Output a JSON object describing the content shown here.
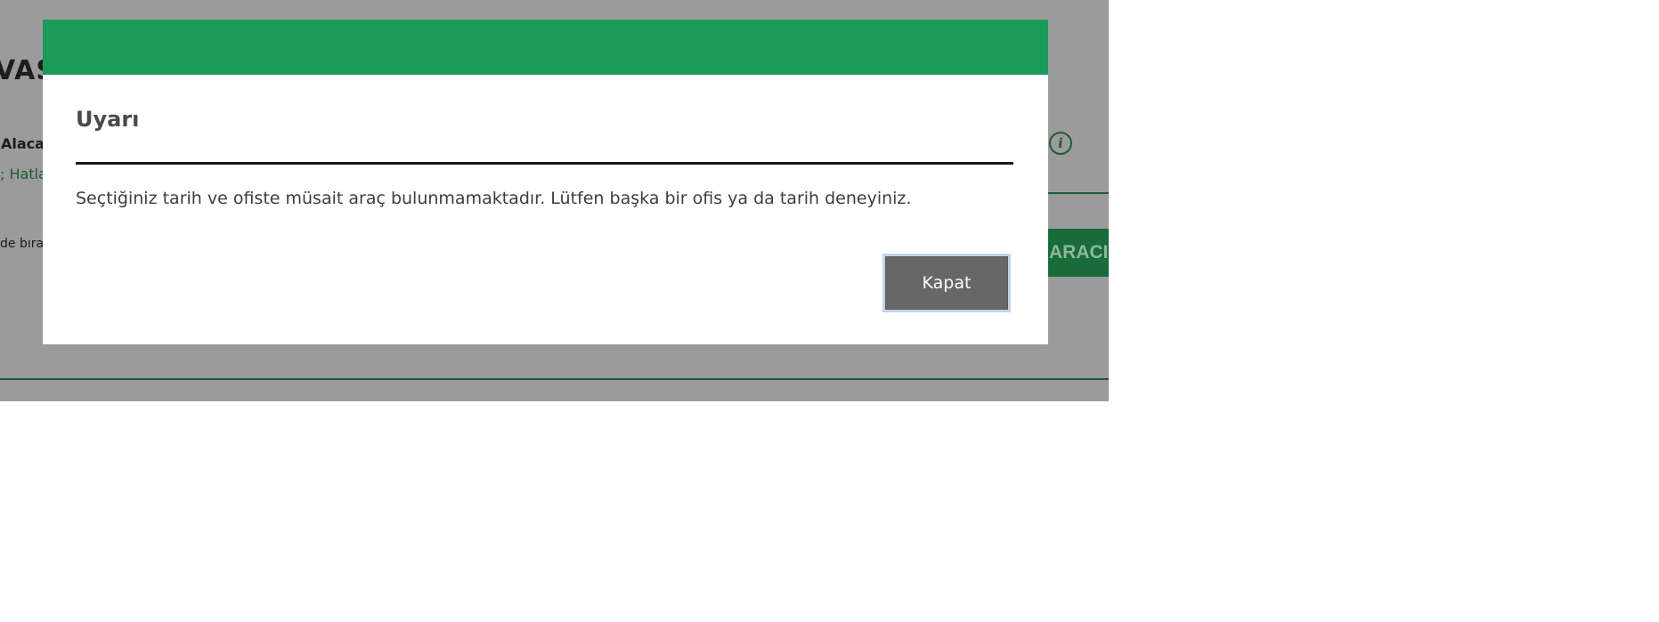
{
  "background": {
    "title_fragment": "VAS",
    "pickup_label_fragment": "Alacak",
    "link_fragment": "; Hatlar",
    "dropoff_fragment": "de bırak",
    "search_button_fragment": "ARACI I",
    "info_icon": "info-icon",
    "accent_color": "#1e5c33"
  },
  "modal": {
    "header_color": "#1a9b5a",
    "title": "Uyarı",
    "message": "Seçtiğiniz tarih ve ofiste müsait araç bulunmamaktadır. Lütfen başka bir ofis ya da tarih deneyiniz.",
    "close_label": "Kapat"
  }
}
